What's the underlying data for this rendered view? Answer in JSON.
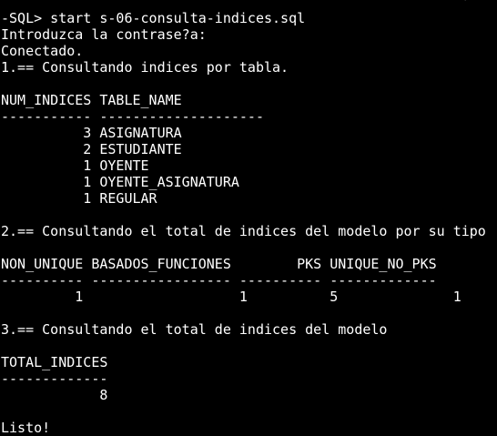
{
  "terminal": {
    "top_cutoff": "                                                        '",
    "lines": {
      "cmd": "-SQL> start s-06-consulta-indices.sql",
      "password_prompt": "Introduzca la contrase?a:",
      "connected": "Conectado.",
      "section1_title": "1.== Consultando indices por tabla.",
      "t1_header": "NUM_INDICES TABLE_NAME",
      "t1_sep": "----------- --------------------",
      "section2_title": "2.== Consultando el total de indices del modelo por su tipo",
      "t2_header": "NON_UNIQUE BASADOS_FUNCIONES        PKS UNIQUE_NO_PKS",
      "t2_sep": "---------- ----------------- ---------- -------------",
      "section3_title": "3.== Consultando el total de indices del modelo",
      "t3_header": "TOTAL_INDICES",
      "t3_sep": "-------------",
      "done": "Listo!"
    },
    "table1_rows": [
      {
        "num": "          3",
        "name": "ASIGNATURA"
      },
      {
        "num": "          2",
        "name": "ESTUDIANTE"
      },
      {
        "num": "          1",
        "name": "OYENTE"
      },
      {
        "num": "          1",
        "name": "OYENTE_ASIGNATURA"
      },
      {
        "num": "          1",
        "name": "REGULAR"
      }
    ],
    "table2_row": {
      "non_unique": "         1",
      "basados_funciones": "                  1",
      "pks": "          5",
      "unique_no_pks": "             1"
    },
    "table3_row": {
      "total": "            8"
    }
  }
}
